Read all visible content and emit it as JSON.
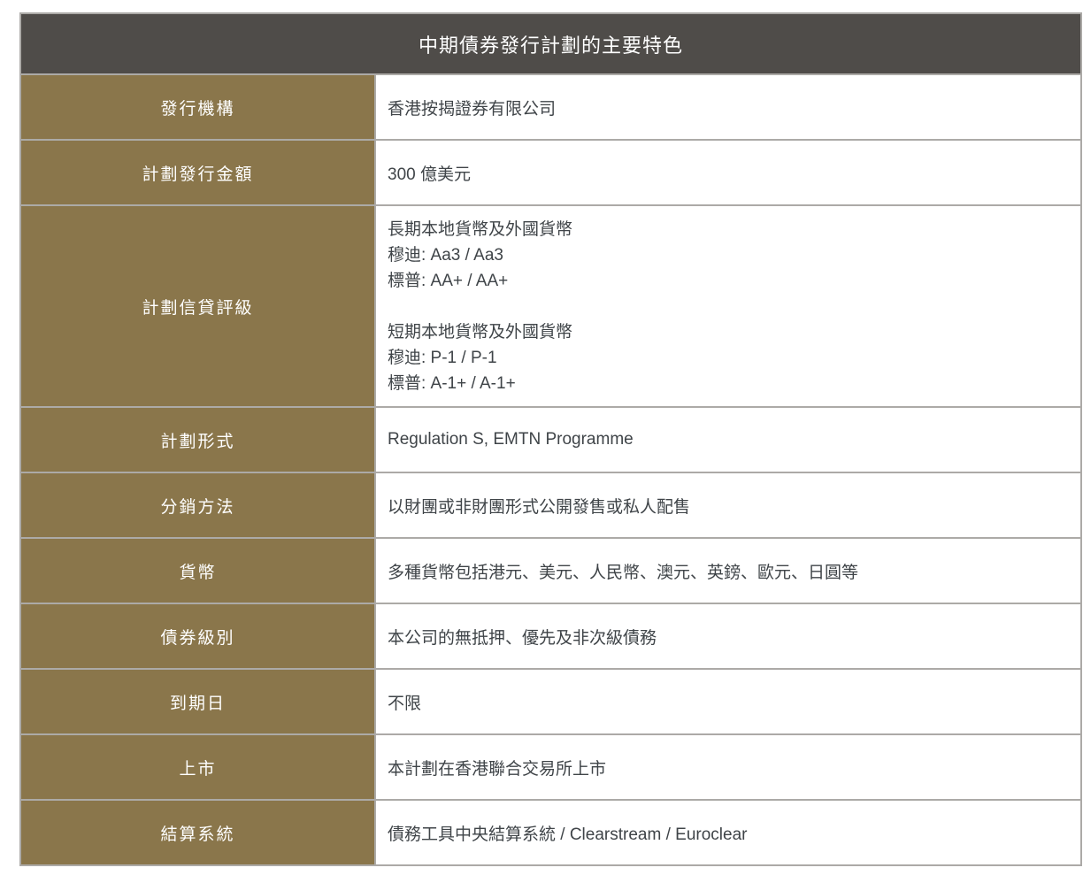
{
  "colors": {
    "title_bar_bg": "#4f4c49",
    "label_cell_bg": "#8a764b",
    "value_cell_bg": "#ffffff",
    "border": "#acaaa7",
    "title_text": "#ffffff",
    "label_text": "#ffffff",
    "value_text": "#3f4448"
  },
  "table": {
    "title": "中期債券發行計劃的主要特色",
    "rows": [
      {
        "label": "發行機構",
        "value": "香港按揭證券有限公司"
      },
      {
        "label": "計劃發行金額",
        "value": "300 億美元"
      },
      {
        "label": "計劃信貸評級",
        "lines": [
          "長期本地貨幣及外國貨幣",
          "穆迪: Aa3 / Aa3",
          "標普: AA+ / AA+",
          "",
          "短期本地貨幣及外國貨幣",
          "穆迪: P-1 / P-1",
          "標普: A-1+ / A-1+"
        ]
      },
      {
        "label": "計劃形式",
        "value": "Regulation S, EMTN Programme"
      },
      {
        "label": "分銷方法",
        "value": "以財團或非財團形式公開發售或私人配售"
      },
      {
        "label": "貨幣",
        "value": "多種貨幣包括港元、美元、人民幣、澳元、英鎊、歐元、日圓等"
      },
      {
        "label": "債券級別",
        "value": "本公司的無抵押、優先及非次級債務"
      },
      {
        "label": "到期日",
        "value": "不限"
      },
      {
        "label": "上市",
        "value": "本計劃在香港聯合交易所上市"
      },
      {
        "label": "結算系統",
        "value": "債務工具中央結算系統 / Clearstream / Euroclear"
      }
    ]
  }
}
